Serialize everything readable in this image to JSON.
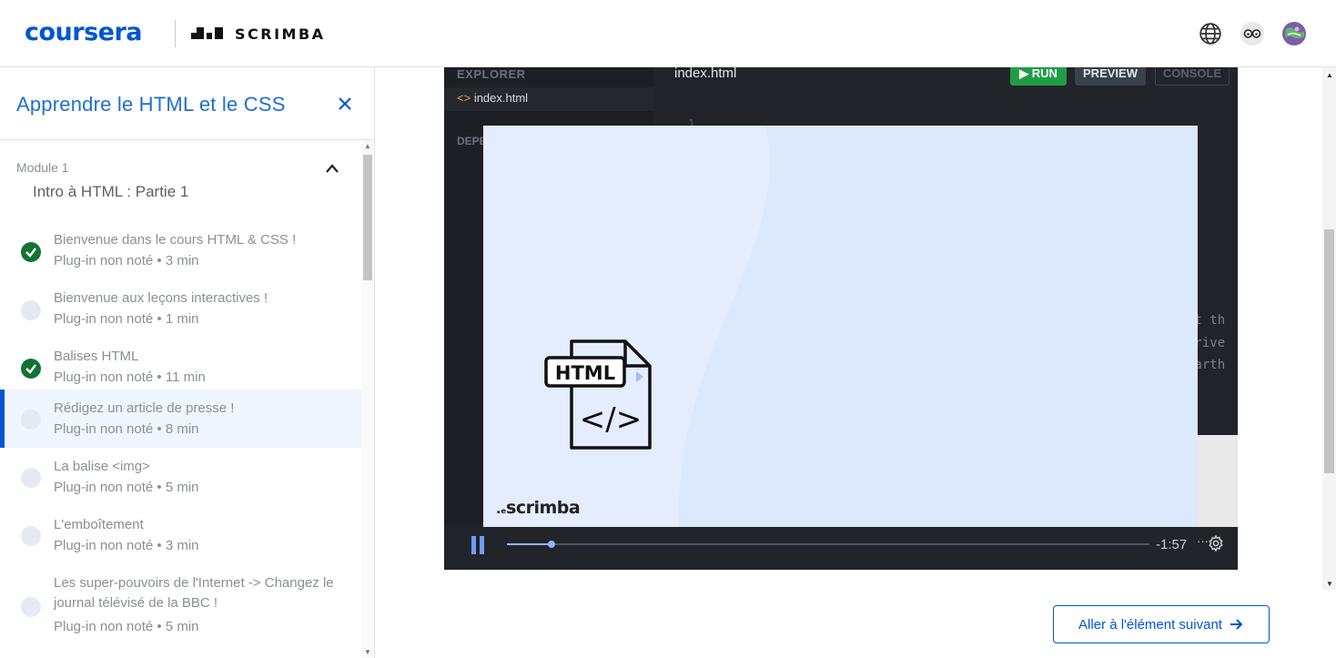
{
  "header": {
    "brand": "coursera",
    "partner": "SCRIMBA",
    "icons": [
      "globe-icon",
      "glasses-avatar-icon",
      "user-avatar-icon"
    ]
  },
  "sidebar": {
    "course_title": "Apprendre le HTML et le CSS",
    "module_label": "Module 1",
    "module_name": "Intro à HTML : Partie 1",
    "items": [
      {
        "title": "Bienvenue dans le cours HTML & CSS !",
        "meta": "Plug-in non noté • 3 min",
        "status": "done"
      },
      {
        "title": "Bienvenue aux leçons interactives !",
        "meta": "Plug-in non noté • 1 min",
        "status": "todo"
      },
      {
        "title": "Balises HTML",
        "meta": "Plug-in non noté • 11 min",
        "status": "done"
      },
      {
        "title": "Rédigez un article de presse !",
        "meta": "Plug-in non noté • 8 min",
        "status": "active"
      },
      {
        "title": "La balise <img>",
        "meta": "Plug-in non noté • 5 min",
        "status": "todo"
      },
      {
        "title": "L'emboîtement",
        "meta": "Plug-in non noté • 3 min",
        "status": "todo"
      },
      {
        "title": "Les super-pouvoirs de l'Internet -> Changez le journal télévisé de la BBC !",
        "meta": "Plug-in non noté • 5 min",
        "status": "todo"
      }
    ]
  },
  "player": {
    "explorer_label": "EXPLORER",
    "file_name": "index.html",
    "deps_label": "DEPE",
    "tab_name": "index.html",
    "run_label": "RUN",
    "preview_label": "PREVIEW",
    "console_label": "CONSOLE",
    "line_no": "1",
    "code_fragments": [
      "et th",
      "rrive",
      "Earth"
    ],
    "slide_badge": "HTML",
    "slide_code": "</>",
    "slide_brand": "scrimba",
    "time_remaining": "-1:57",
    "more": "···",
    "progress": 0.07
  },
  "next_button": {
    "label": "Aller à l'élément suivant"
  },
  "colors": {
    "brand_blue": "#0056d2",
    "done_green": "#137333",
    "run_green": "#1f9d45",
    "slide_bg": "#dce8fc"
  }
}
